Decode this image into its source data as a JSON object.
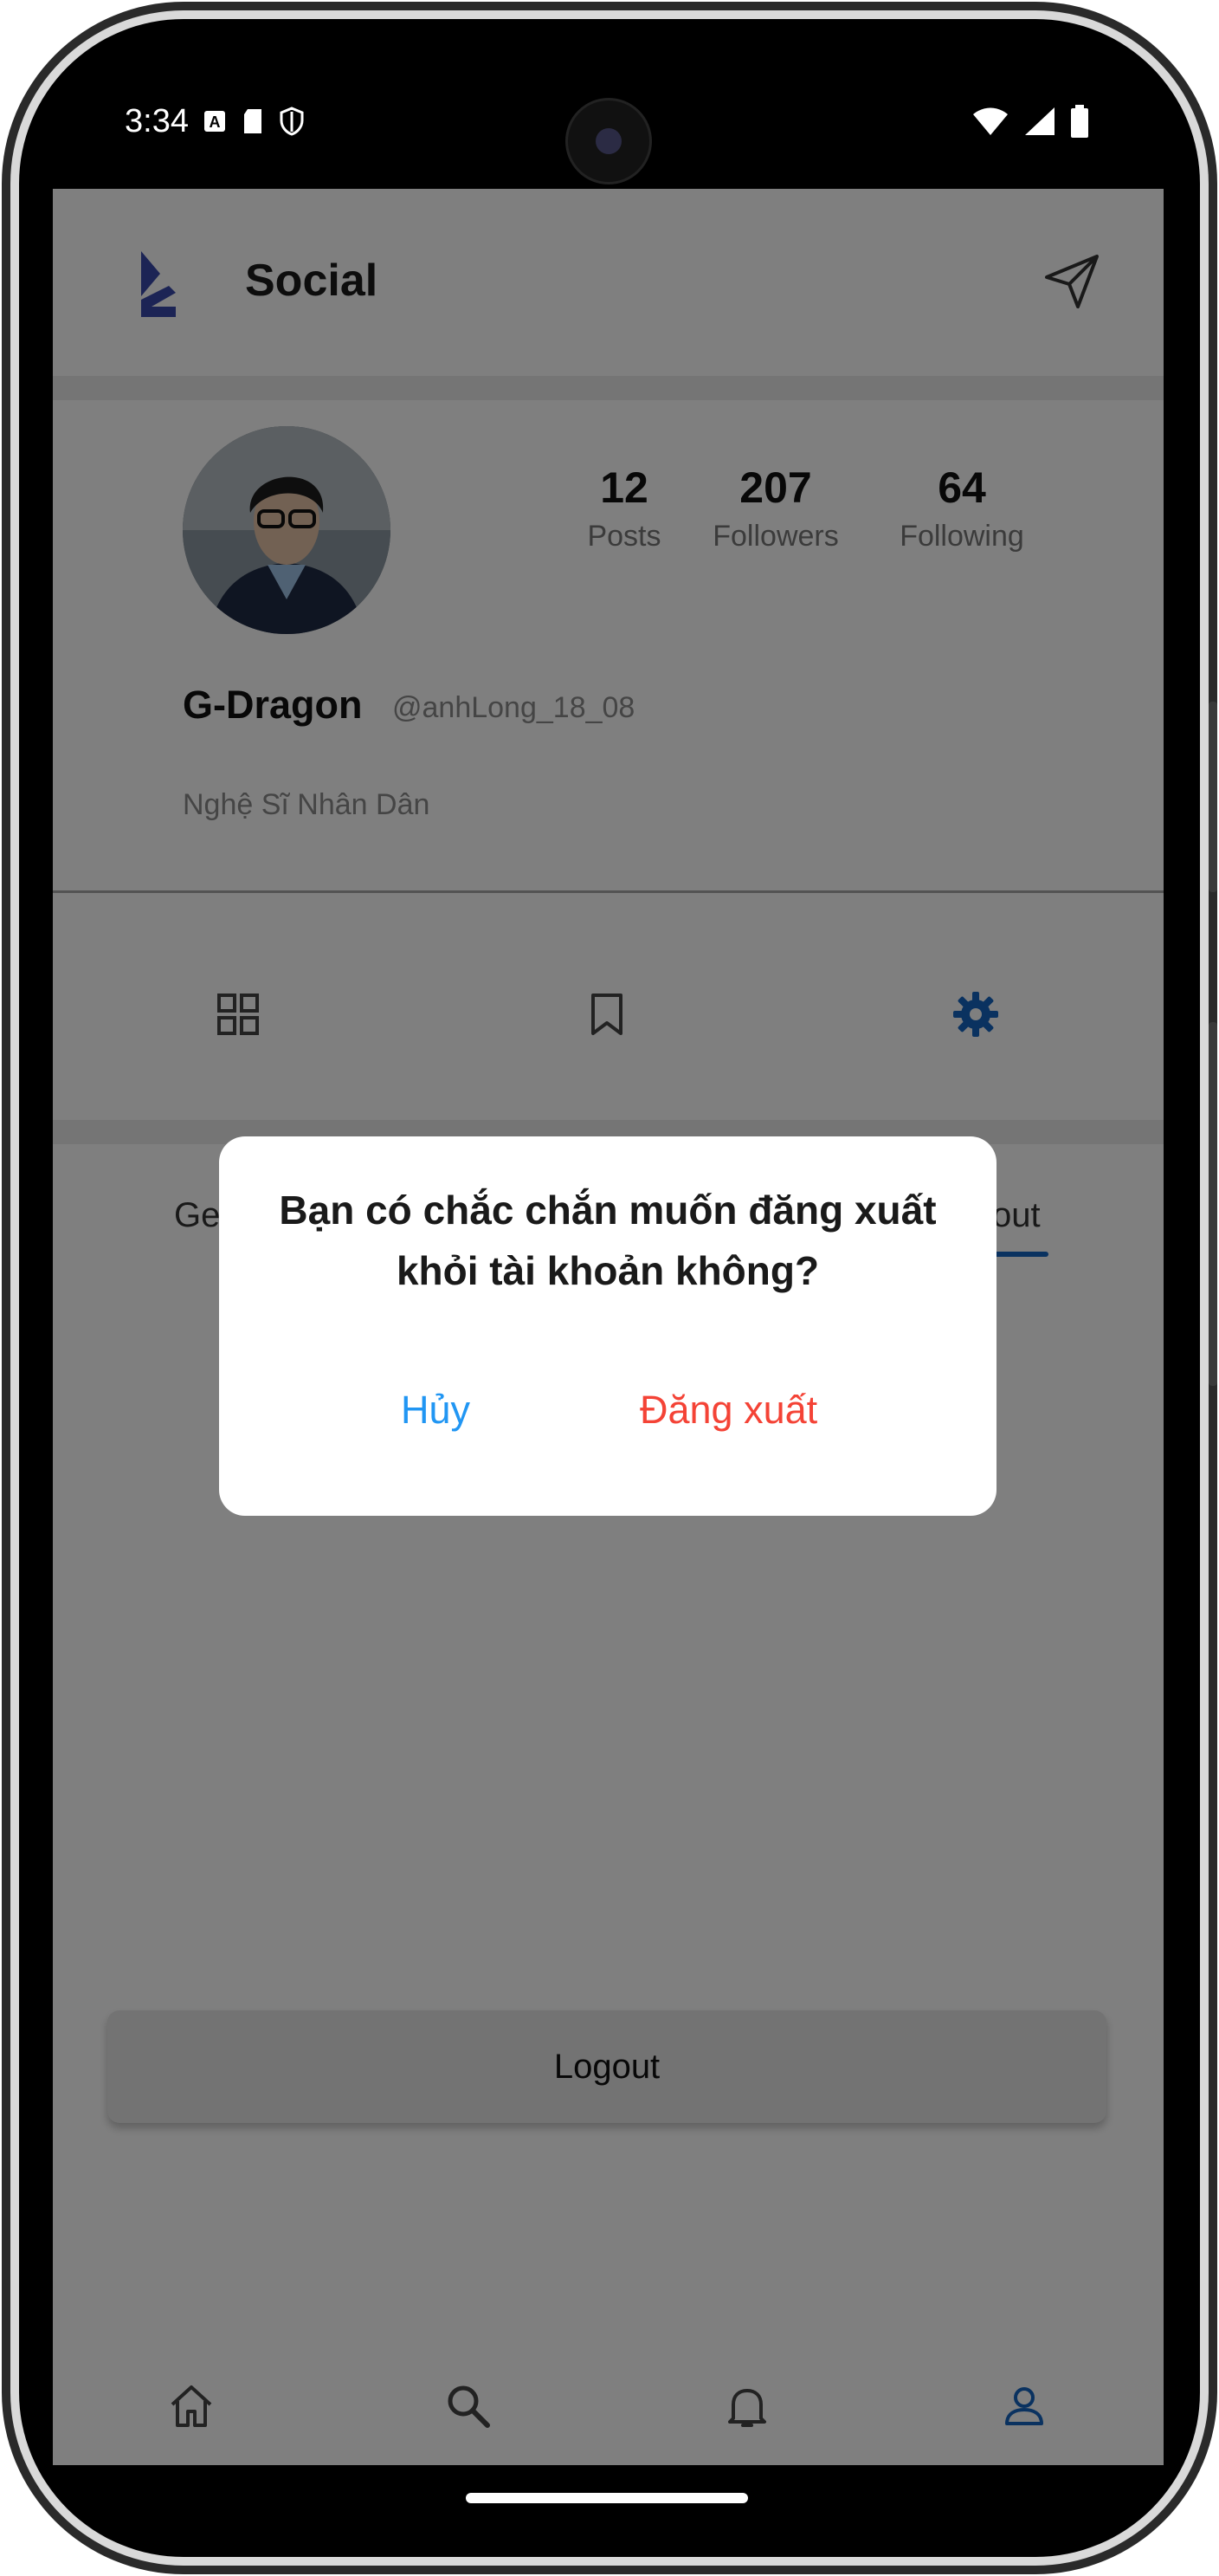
{
  "status_bar": {
    "time": "3:34"
  },
  "app": {
    "title": "Social",
    "accent": "#1565c0"
  },
  "profile": {
    "stats": [
      {
        "value": "12",
        "label": "Posts"
      },
      {
        "value": "207",
        "label": "Followers"
      },
      {
        "value": "64",
        "label": "Following"
      }
    ],
    "name": "G-Dragon",
    "handle": "@anhLong_18_08",
    "bio": "Nghệ Sĩ Nhân Dân"
  },
  "profile_tabs": [
    {
      "icon": "grid-icon",
      "active": false
    },
    {
      "icon": "bookmark-icon",
      "active": false
    },
    {
      "icon": "gear-icon",
      "active": true
    }
  ],
  "settings": {
    "subtab_left_partial": "Ge",
    "subtab_right_partial": "out",
    "logout_label": "Logout"
  },
  "bottom_nav": [
    {
      "icon": "home-icon",
      "active": false
    },
    {
      "icon": "search-icon",
      "active": false
    },
    {
      "icon": "bell-icon",
      "active": false
    },
    {
      "icon": "person-icon",
      "active": true
    }
  ],
  "dialog": {
    "message": "Bạn có chắc chắn muốn đăng xuất khỏi tài khoản không?",
    "cancel_label": "Hủy",
    "confirm_label": "Đăng xuất",
    "cancel_color": "#2196f3",
    "confirm_color": "#f44336"
  }
}
